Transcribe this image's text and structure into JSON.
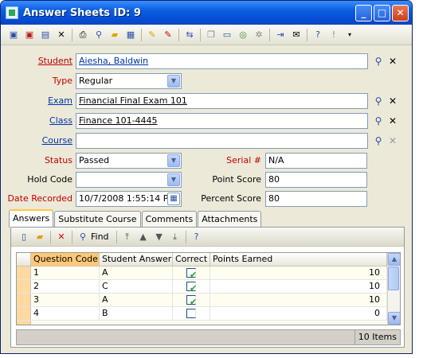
{
  "window": {
    "title": "Answer Sheets ID: 9"
  },
  "form": {
    "student": {
      "label": "Student",
      "value": "Aiesha, Baldwin"
    },
    "type": {
      "label": "Type",
      "value": "Regular"
    },
    "exam": {
      "label": "Exam",
      "value": "Financial Final Exam 101"
    },
    "class": {
      "label": "Class",
      "value": "Finance 101-4445"
    },
    "course": {
      "label": "Course",
      "value": ""
    },
    "status": {
      "label": "Status",
      "value": "Passed"
    },
    "hold_code": {
      "label": "Hold Code",
      "value": ""
    },
    "date_recorded": {
      "label": "Date Recorded",
      "value": "10/7/2008 1:55:14 PM"
    },
    "serial": {
      "label": "Serial #",
      "value": "N/A"
    },
    "point_score": {
      "label": "Point Score",
      "value": "80"
    },
    "percent_score": {
      "label": "Percent Score",
      "value": "80"
    }
  },
  "tabs": [
    "Answers",
    "Substitute Course",
    "Comments",
    "Attachments"
  ],
  "grid_toolbar": {
    "find_label": "Find"
  },
  "grid": {
    "columns": [
      "Question Code",
      "Student Answer",
      "Correct",
      "Points Earned"
    ],
    "rows": [
      {
        "code": "1",
        "answer": "A",
        "correct": true,
        "points": "10"
      },
      {
        "code": "2",
        "answer": "C",
        "correct": true,
        "points": "10"
      },
      {
        "code": "3",
        "answer": "A",
        "correct": true,
        "points": "10"
      },
      {
        "code": "4",
        "answer": "B",
        "correct": false,
        "points": "0"
      }
    ]
  },
  "status_bar": {
    "count": "10 Items"
  }
}
